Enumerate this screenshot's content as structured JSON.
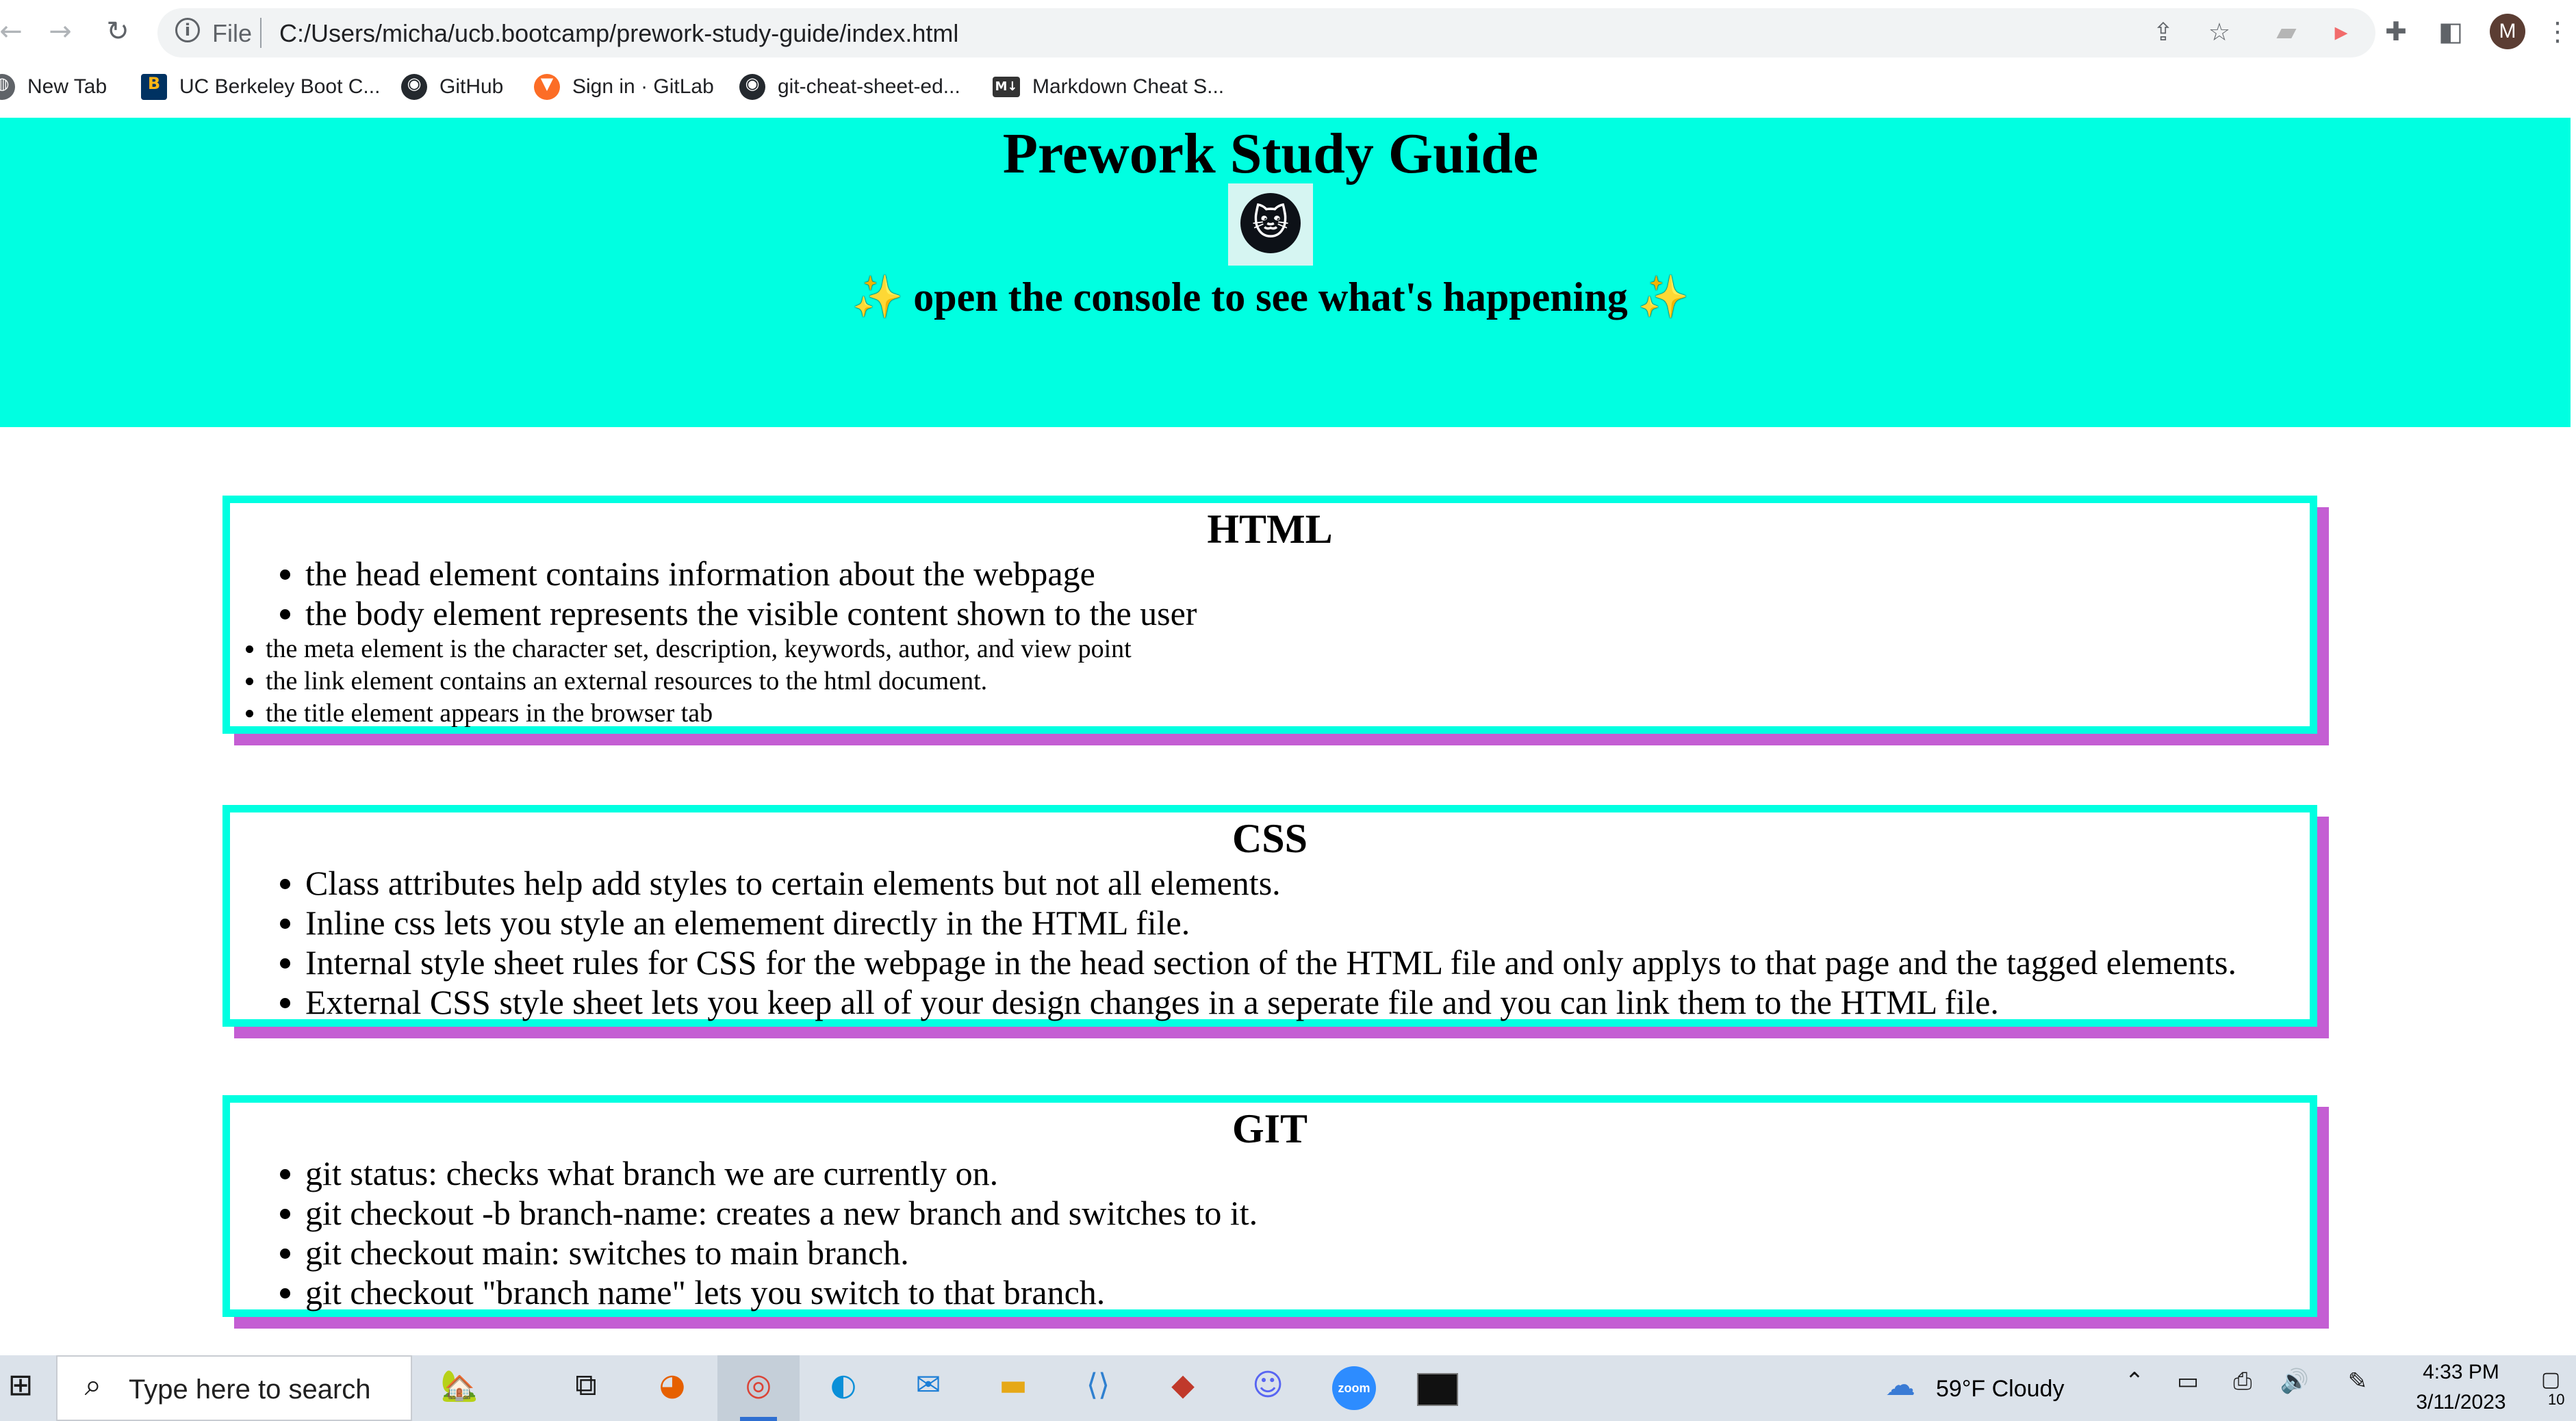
{
  "browser": {
    "nav": {
      "back_icon": "back-arrow-icon",
      "forward_icon": "forward-arrow-icon",
      "reload_icon": "reload-icon"
    },
    "omnibox": {
      "scheme_label": "File",
      "url": "C:/Users/micha/ucb.bootcamp/prework-study-guide/index.html"
    },
    "profile_initial": "M",
    "bookmarks": [
      {
        "label": "New Tab",
        "icon": "globe-icon"
      },
      {
        "label": "UC Berkeley Boot C...",
        "icon": "ucb-icon"
      },
      {
        "label": "GitHub",
        "icon": "github-icon"
      },
      {
        "label": "Sign in · GitLab",
        "icon": "gitlab-icon"
      },
      {
        "label": "git-cheat-sheet-ed...",
        "icon": "github-icon"
      },
      {
        "label": "Markdown Cheat S...",
        "icon": "markdown-icon"
      }
    ]
  },
  "page": {
    "title": "Prework Study Guide",
    "subtitle": "open the console to see what's happening",
    "sparkle": "✨",
    "colors": {
      "hero_bg": "#00ffe1",
      "card_border": "#00ffe1",
      "card_shadow": "#c45ed3"
    },
    "sections": [
      {
        "heading": "HTML",
        "items": [
          "the head element contains information about the webpage",
          "the body element represents the visible content shown to the user"
        ],
        "small_items": [
          "the meta element is the character set, description, keywords, author, and view point",
          "the link element contains an external resources to the html document.",
          "the title element appears in the browser tab"
        ]
      },
      {
        "heading": "CSS",
        "items": [
          "Class attributes help add styles to certain elements but not all elements.",
          "Inline css lets you style an elemement directly in the HTML file.",
          "Internal style sheet rules for CSS for the webpage in the head section of the HTML file and only applys to that page and the tagged elements.",
          "External CSS style sheet lets you keep all of your design changes in a seperate file and you can link them to the HTML file."
        ]
      },
      {
        "heading": "GIT",
        "items": [
          "git status: checks what branch we are currently on.",
          "git checkout -b branch-name: creates a new branch and switches to it.",
          "git checkout main: switches to main branch.",
          "git checkout \"branch name\" lets you switch to that branch."
        ]
      }
    ]
  },
  "taskbar": {
    "search_placeholder": "Type here to search",
    "weather": "59°F  Cloudy",
    "time": "4:33 PM",
    "date": "3/11/2023",
    "notification_count": "10",
    "zoom_label": "zoom"
  }
}
